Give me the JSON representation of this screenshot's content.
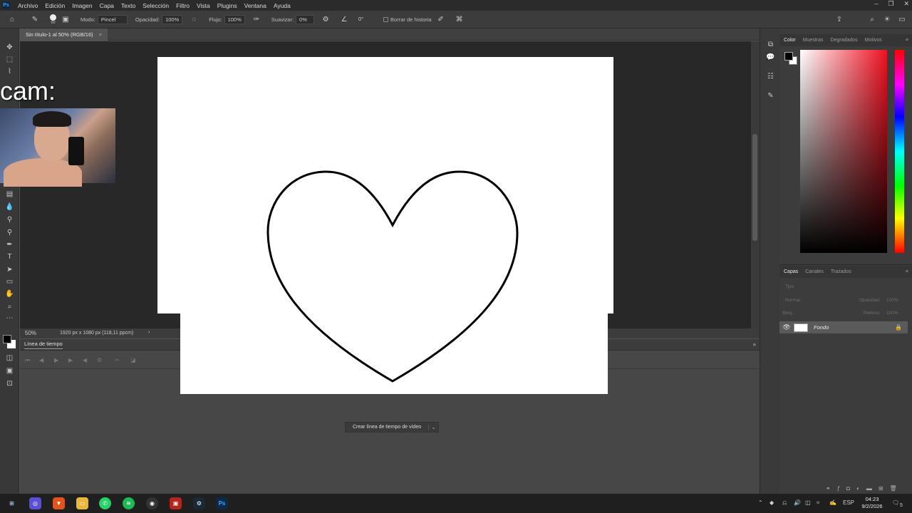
{
  "app": {
    "logo": "Ps"
  },
  "menu": [
    "Archivo",
    "Edición",
    "Imagen",
    "Capa",
    "Texto",
    "Selección",
    "Filtro",
    "Vista",
    "Plugins",
    "Ventana",
    "Ayuda"
  ],
  "options": {
    "brush_size": "60",
    "mode_label": "Modo:",
    "mode_value": "Pincel",
    "opacity_label": "Opacidad:",
    "opacity_value": "100%",
    "flow_label": "Flujo:",
    "flow_value": "100%",
    "smooth_label": "Suavizar:",
    "smooth_value": "0%",
    "angle_value": "0°",
    "history_label": "Borrar de historia"
  },
  "document": {
    "tab_title": "Sin título-1 al 50% (RGB/16)",
    "close": "×"
  },
  "status": {
    "zoom": "50%",
    "info": "1920 px x 1080 px (118,11 ppcm)"
  },
  "timeline": {
    "title": "Línea de tiempo",
    "create_button": "Crear línea de tiempo de vídeo"
  },
  "color_panel": {
    "tabs": [
      "Color",
      "Muestras",
      "Degradados",
      "Motivos"
    ],
    "fg": "#000000",
    "bg": "#ffffff"
  },
  "layers_panel": {
    "tabs": [
      "Capas",
      "Canales",
      "Trazados"
    ],
    "search_placeholder": "Tipo",
    "blend": "Normal",
    "opacity_label": "Opacidad:",
    "opacity_value": "100%",
    "lock_label": "Bloq.:",
    "fill_label": "Relleno:",
    "fill_value": "100%",
    "layer_name": "Fondo"
  },
  "overlay": {
    "cam_label": "cam:"
  },
  "taskbar": {
    "lang": "ESP",
    "time": "04:23",
    "date": "9/2/2026",
    "notif": "5"
  }
}
